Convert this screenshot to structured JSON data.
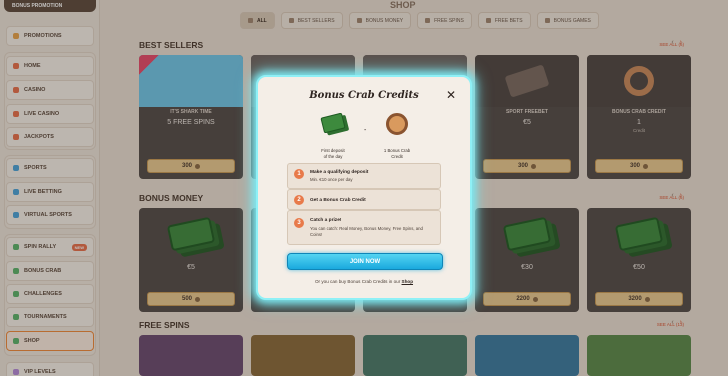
{
  "sidebar": {
    "promo_top": "BONUS PROMOTION",
    "items": [
      {
        "label": "PROMOTIONS",
        "icon": "gift-icon"
      },
      {
        "label": "HOME",
        "icon": "home-icon"
      },
      {
        "label": "CASINO",
        "icon": "casino-icon"
      },
      {
        "label": "LIVE CASINO",
        "icon": "live-casino-icon"
      },
      {
        "label": "JACKPOTS",
        "icon": "jackpot-icon"
      },
      {
        "label": "SPORTS",
        "icon": "sports-icon"
      },
      {
        "label": "LIVE BETTING",
        "icon": "live-betting-icon"
      },
      {
        "label": "VIRTUAL SPORTS",
        "icon": "virtual-sports-icon"
      },
      {
        "label": "SPIN RALLY",
        "icon": "spin-rally-icon",
        "badge": "NEW"
      },
      {
        "label": "BONUS CRAB",
        "icon": "crab-icon"
      },
      {
        "label": "CHALLENGES",
        "icon": "challenges-icon"
      },
      {
        "label": "TOURNAMENTS",
        "icon": "tournaments-icon"
      },
      {
        "label": "SHOP",
        "icon": "shop-icon",
        "active": true
      },
      {
        "label": "VIP LEVELS",
        "icon": "vip-icon"
      }
    ]
  },
  "main": {
    "title": "SHOP",
    "tabs": [
      {
        "label": "ALL",
        "active": true
      },
      {
        "label": "BEST SELLERS"
      },
      {
        "label": "BONUS MONEY"
      },
      {
        "label": "FREE SPINS"
      },
      {
        "label": "FREE BETS"
      },
      {
        "label": "BONUS GAMES"
      }
    ],
    "sections": [
      {
        "title": "BEST SELLERS",
        "see_all": "SEE ALL (6)"
      },
      {
        "title": "BONUS MONEY",
        "see_all": "SEE ALL (6)"
      },
      {
        "title": "FREE SPINS",
        "see_all": "SEE ALL (13)"
      }
    ],
    "best_sellers": [
      {
        "name": "IT'S SHARK TIME",
        "value": "5 FREE SPINS",
        "price": "300"
      },
      {
        "name": "",
        "value": "",
        "price": ""
      },
      {
        "name": "",
        "value": "",
        "price": ""
      },
      {
        "name": "SPORT FREEBET",
        "value": "€5",
        "price": "300"
      },
      {
        "name": "BONUS CRAB CREDIT",
        "value": "1",
        "sub": "Credit",
        "price": "300"
      }
    ],
    "bonus_money": [
      {
        "value": "€5",
        "price": "500"
      },
      {
        "value": "",
        "price": ""
      },
      {
        "value": "",
        "price": ""
      },
      {
        "value": "€30",
        "price": "2200"
      },
      {
        "value": "€50",
        "price": "3200"
      }
    ]
  },
  "modal": {
    "title": "Bonus Crab Credits",
    "icon1_caption_1": "First deposit",
    "icon1_caption_2": "of the day",
    "dash": "-",
    "icon2_caption_1": "1 Bonus Crab",
    "icon2_caption_2": "Credit",
    "steps": [
      {
        "num": "1",
        "title": "Make a qualifying deposit",
        "desc": "Min. €10 once per day"
      },
      {
        "num": "2",
        "title": "Get a Bonus Crab Credit",
        "desc": ""
      },
      {
        "num": "3",
        "title": "Catch a prize!",
        "desc": "You can catch: Real Money, Bonus Money, Free Spins, and Coins!"
      }
    ],
    "join_label": "JOIN NOW",
    "footer_text": "Or you can buy Bonus Crab Credits in our",
    "footer_link": "Shop"
  },
  "colors": {
    "accent": "#e87a4a",
    "join": "#1aa9de",
    "glow": "#7de8f0"
  }
}
